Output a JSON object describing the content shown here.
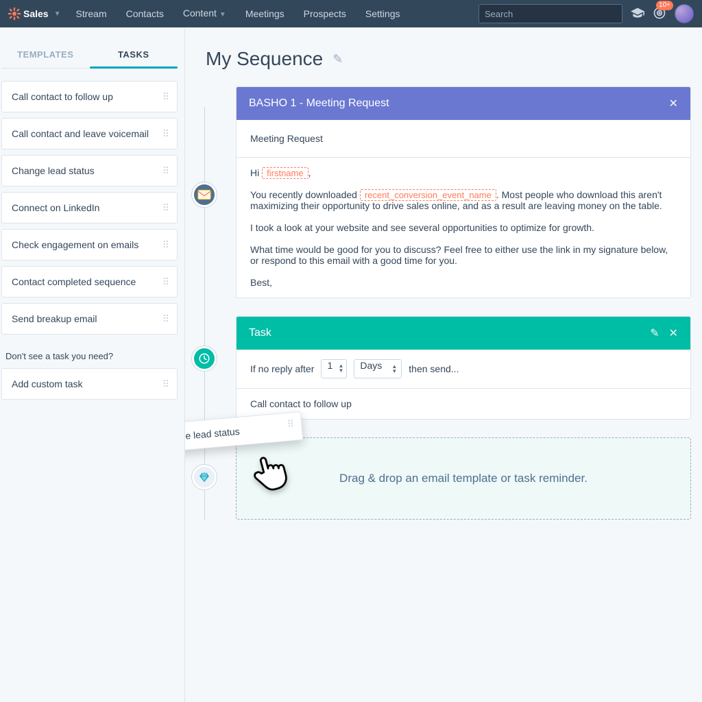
{
  "nav": {
    "brand": "Sales",
    "items": [
      "Stream",
      "Contacts",
      "Content",
      "Meetings",
      "Prospects",
      "Settings"
    ],
    "search_placeholder": "Search",
    "notif_count": "10+"
  },
  "sidebar": {
    "tabs": {
      "templates": "TEMPLATES",
      "tasks": "TASKS"
    },
    "task_items": [
      "Call contact to follow up",
      "Call contact and leave voicemail",
      "Change lead status",
      "Connect on LinkedIn",
      "Check engagement on emails",
      "Contact completed sequence",
      "Send breakup email"
    ],
    "prompt": "Don't see a task you need?",
    "add_custom": "Add custom task"
  },
  "main": {
    "title": "My Sequence",
    "email": {
      "header": "BASHO 1 - Meeting Request",
      "subject": "Meeting Request",
      "greeting_pre": "Hi ",
      "greeting_token": "firstname",
      "greeting_post": ",",
      "p1_pre": "You recently downloaded ",
      "p1_token": "recent_conversion_event_name",
      "p1_post": ". Most people who download this aren't maximizing their opportunity to drive sales online, and as a result are leaving money on the table.",
      "p2": "I took a look at your website and see several opportunities to optimize for growth.",
      "p3": "What time would be good for you to discuss? Feel free to either use the link in my signature below, or respond to this email with a good time for you.",
      "signoff": "Best,"
    },
    "task_card": {
      "header": "Task",
      "if_no_reply": "If no reply after",
      "count": "1",
      "unit": "Days",
      "then_send": "then send...",
      "body": "Call contact to follow up"
    },
    "dropzone": "Drag & drop an email template or task reminder.",
    "dragging_label": "Change lead status"
  }
}
